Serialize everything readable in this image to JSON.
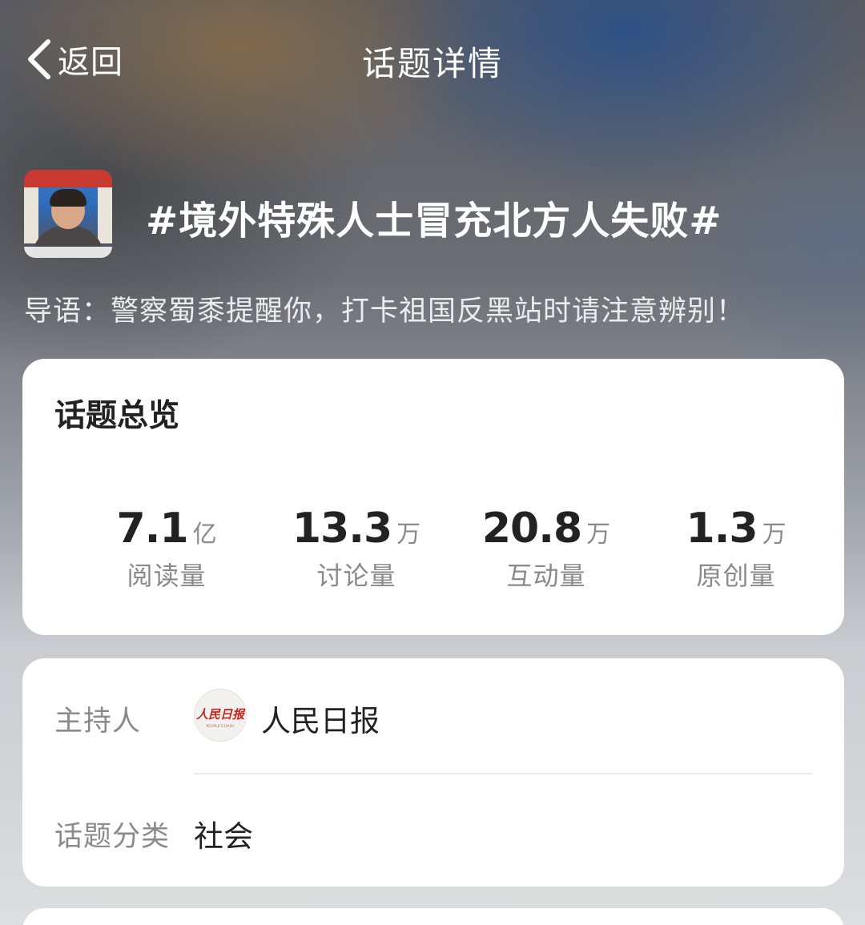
{
  "header": {
    "back_label": "返回",
    "title": "话题详情"
  },
  "topic": {
    "title": "#境外特殊人士冒充北方人失败#",
    "lead": "导语：警察蜀黍提醒你，打卡祖国反黑站时请注意辨别！"
  },
  "overview": {
    "title": "话题总览",
    "stats": [
      {
        "value": "7.1",
        "unit": "亿",
        "label": "阅读量"
      },
      {
        "value": "13.3",
        "unit": "万",
        "label": "讨论量"
      },
      {
        "value": "20.8",
        "unit": "万",
        "label": "互动量"
      },
      {
        "value": "1.3",
        "unit": "万",
        "label": "原创量"
      }
    ]
  },
  "info": {
    "host_label": "主持人",
    "host_name": "人民日报",
    "host_avatar_text": "人民日报",
    "host_avatar_subtext": "PEOPLE'S DAILY",
    "category_label": "话题分类",
    "category_value": "社会"
  },
  "colors": {
    "card_bg": "#ffffff",
    "primary_text": "#222222",
    "secondary_text": "#8a8a8a",
    "avatar_red": "#c8251c"
  }
}
